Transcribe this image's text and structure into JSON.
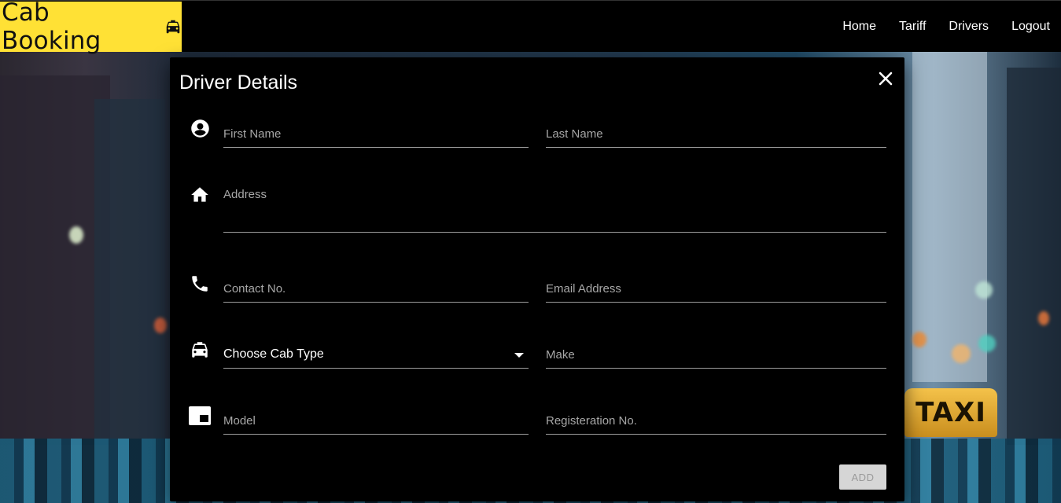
{
  "header": {
    "brand_title": "Cab Booking",
    "brand_icon": "taxi-icon",
    "nav": [
      {
        "label": "Home"
      },
      {
        "label": "Tariff"
      },
      {
        "label": "Drivers"
      },
      {
        "label": "Logout"
      }
    ]
  },
  "background": {
    "sign_text": "TAXI"
  },
  "modal": {
    "title": "Driver Details",
    "close_icon": "close-icon",
    "fields": {
      "first_name": {
        "placeholder": "First Name",
        "value": ""
      },
      "last_name": {
        "placeholder": "Last Name",
        "value": ""
      },
      "address": {
        "placeholder": "Address",
        "value": ""
      },
      "contact": {
        "placeholder": "Contact No.",
        "value": ""
      },
      "email": {
        "placeholder": "Email Address",
        "value": ""
      },
      "cab_type": {
        "selected": "Choose Cab Type"
      },
      "make": {
        "placeholder": "Make",
        "value": ""
      },
      "model": {
        "placeholder": "Model",
        "value": ""
      },
      "registration": {
        "placeholder": "Registeration No.",
        "value": ""
      }
    },
    "icons": [
      "account-circle-icon",
      "home-icon",
      "phone-icon",
      "taxi-icon",
      "picture-in-picture-icon"
    ],
    "add_label": "ADD"
  },
  "colors": {
    "brand": "#ffe135",
    "header_bg": "#000000",
    "modal_bg": "#000000",
    "underline": "#9e9e9e",
    "disabled_button": "#d6d6d6"
  }
}
